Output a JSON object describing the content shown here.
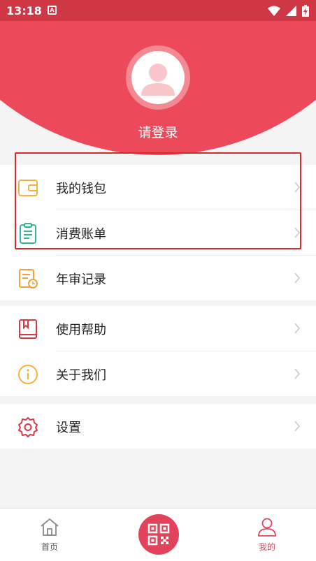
{
  "status_bar": {
    "time": "13:18",
    "notification_letter": "A"
  },
  "profile": {
    "login_label": "请登录"
  },
  "menu": {
    "group1": [
      {
        "label": "我的钱包",
        "icon": "wallet-icon"
      },
      {
        "label": "消费账单",
        "icon": "bill-icon"
      },
      {
        "label": "年审记录",
        "icon": "inspection-record-icon"
      }
    ],
    "group2": [
      {
        "label": "使用帮助",
        "icon": "help-book-icon"
      },
      {
        "label": "关于我们",
        "icon": "info-icon"
      }
    ],
    "group3": [
      {
        "label": "设置",
        "icon": "settings-gear-icon"
      }
    ]
  },
  "bottom_nav": {
    "home_label": "首页",
    "mine_label": "我的"
  },
  "colors": {
    "brand": "#ec4a5a",
    "statusbar": "#cf3744",
    "highlight_border": "#d62b2b",
    "active_tab": "#e3435a"
  }
}
